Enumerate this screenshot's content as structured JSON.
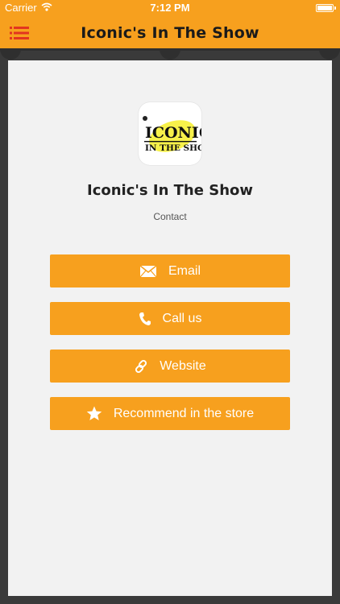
{
  "status_bar": {
    "carrier": "Carrier",
    "time": "7:12 PM"
  },
  "header": {
    "title": "Iconic's In The Show",
    "menu_icon": "list-menu-icon"
  },
  "logo": {
    "line1": "ICONIC",
    "line2": "IN THE SHOW"
  },
  "app": {
    "name": "Iconic's In The Show",
    "subtitle": "Contact"
  },
  "buttons": {
    "email": {
      "label": "Email",
      "icon": "envelope-icon"
    },
    "call": {
      "label": "Call us",
      "icon": "phone-icon"
    },
    "website": {
      "label": "Website",
      "icon": "link-icon"
    },
    "recommend": {
      "label": "Recommend in the store",
      "icon": "star-icon"
    }
  },
  "colors": {
    "accent": "#f7a01e",
    "menu_icon": "#e2351f",
    "frame": "#3a3a3a",
    "card": "#f2f2f2"
  }
}
